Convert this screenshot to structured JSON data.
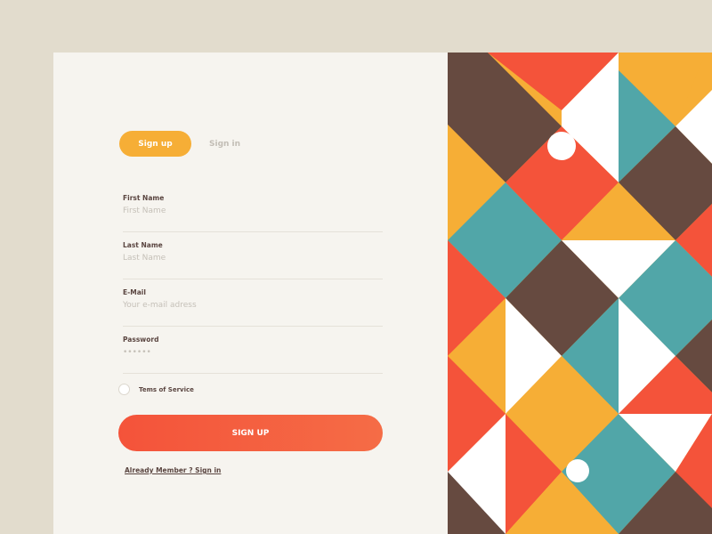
{
  "tabs": {
    "signup_label": "Sign up",
    "signin_label": "Sign in",
    "active": "signup"
  },
  "fields": [
    {
      "label": "First Name",
      "placeholder": "First Name",
      "value": ""
    },
    {
      "label": "Last Name",
      "placeholder": "Last Name",
      "value": ""
    },
    {
      "label": "E-Mail",
      "placeholder": "Your e-mail adress",
      "value": ""
    },
    {
      "label": "Password",
      "placeholder": "••••••",
      "value": ""
    }
  ],
  "terms": {
    "label": "Tems of Service",
    "checked": false
  },
  "submit_label": "SIGN UP",
  "member_link": "Already Member ? Sign in",
  "colors": {
    "background": "#e2dccd",
    "card": "#f6f4ef",
    "accent_orange": "#f6ae36",
    "accent_red": "#f4533a",
    "brown": "#664a40",
    "teal": "#51a6a8",
    "white": "#ffffff"
  }
}
